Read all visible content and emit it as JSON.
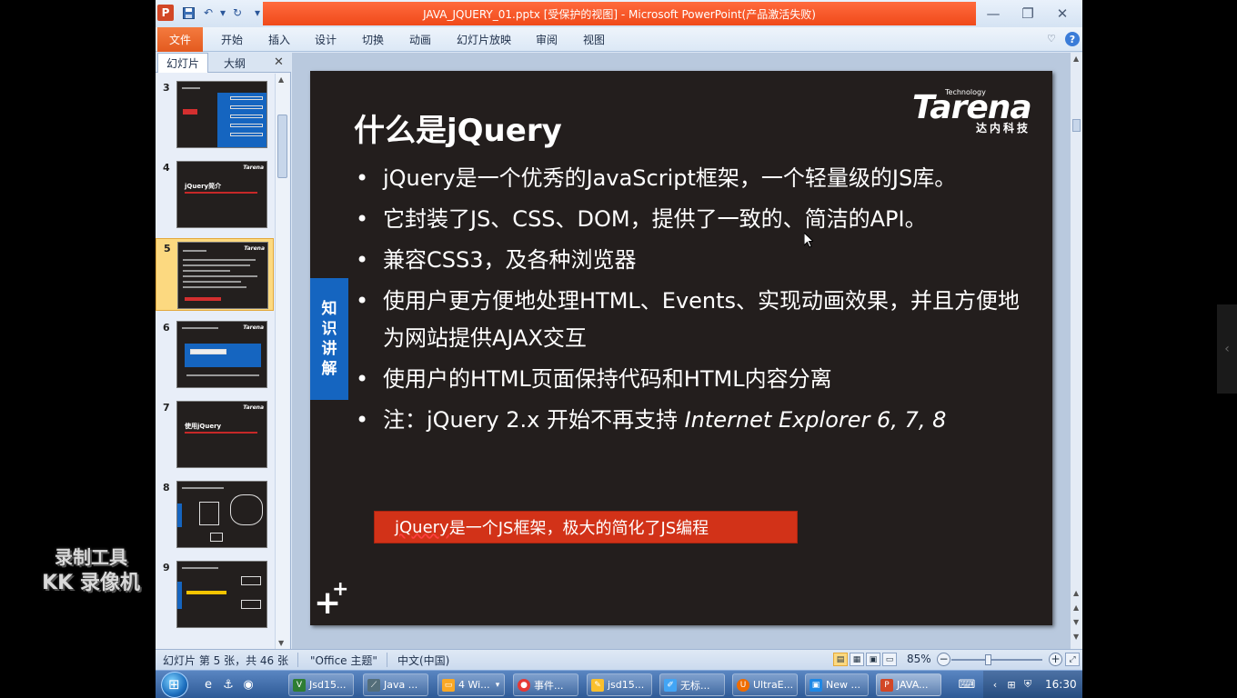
{
  "window": {
    "title": "JAVA_JQUERY_01.pptx [受保护的视图] - Microsoft PowerPoint(产品激活失败)",
    "app_logo": "P"
  },
  "ribbon": {
    "tabs": [
      "文件",
      "开始",
      "插入",
      "设计",
      "切换",
      "动画",
      "幻灯片放映",
      "审阅",
      "视图"
    ]
  },
  "pane": {
    "tabs": [
      "幻灯片",
      "大纲"
    ],
    "thumbnails": [
      {
        "num": "3"
      },
      {
        "num": "4",
        "title": "jQuery简介"
      },
      {
        "num": "5"
      },
      {
        "num": "6"
      },
      {
        "num": "7",
        "title": "使用jQuery"
      },
      {
        "num": "8"
      },
      {
        "num": "9"
      }
    ],
    "thumb_logo": "Tarena"
  },
  "slide": {
    "title": "什么是jQuery",
    "logo": {
      "top": "Technology",
      "word": "Tarena",
      "cn": "达内科技"
    },
    "side_tag": [
      "知",
      "识",
      "讲",
      "解"
    ],
    "bullets": [
      "jQuery是一个优秀的JavaScript框架，一个轻量级的JS库。",
      "它封装了JS、CSS、DOM，提供了一致的、简洁的API。",
      "兼容CSS3，及各种浏览器",
      "使用户更方便地处理HTML、Events、实现动画效果，并且方便地为网站提供AJAX交互",
      "使用户的HTML页面保持代码和HTML内容分离"
    ],
    "last_bullet": {
      "prefix": "注：jQuery 2.x 开始不再支持 ",
      "italic": "Internet Explorer 6, 7, 8"
    },
    "note": {
      "underlined": "jQuery",
      "rest": "是一个JS框架，极大的简化了JS编程"
    }
  },
  "status": {
    "slide_info": "幻灯片 第 5 张，共 46 张",
    "theme": "\"Office 主题\"",
    "language": "中文(中国)",
    "zoom": "85%"
  },
  "taskbar": {
    "items": [
      {
        "label": "Jsd15...",
        "icon_color": "#2e7d32"
      },
      {
        "label": "Java ...",
        "icon_color": "#546e7a"
      },
      {
        "label": "4 Wi...",
        "icon_color": "#f9a825"
      },
      {
        "label": "事件...",
        "icon_color": "#e53935"
      },
      {
        "label": "jsd15...",
        "icon_color": "#fbc02d"
      },
      {
        "label": "无标...",
        "icon_color": "#42a5f5"
      },
      {
        "label": "UltraE...",
        "icon_color": "#ef6c00"
      },
      {
        "label": "New ...",
        "icon_color": "#1e88e5"
      },
      {
        "label": "JAVA...",
        "icon_color": "#d24726"
      }
    ],
    "clock": "16:30"
  },
  "watermark": {
    "line1": "录制工具",
    "line2": "KK 录像机"
  }
}
